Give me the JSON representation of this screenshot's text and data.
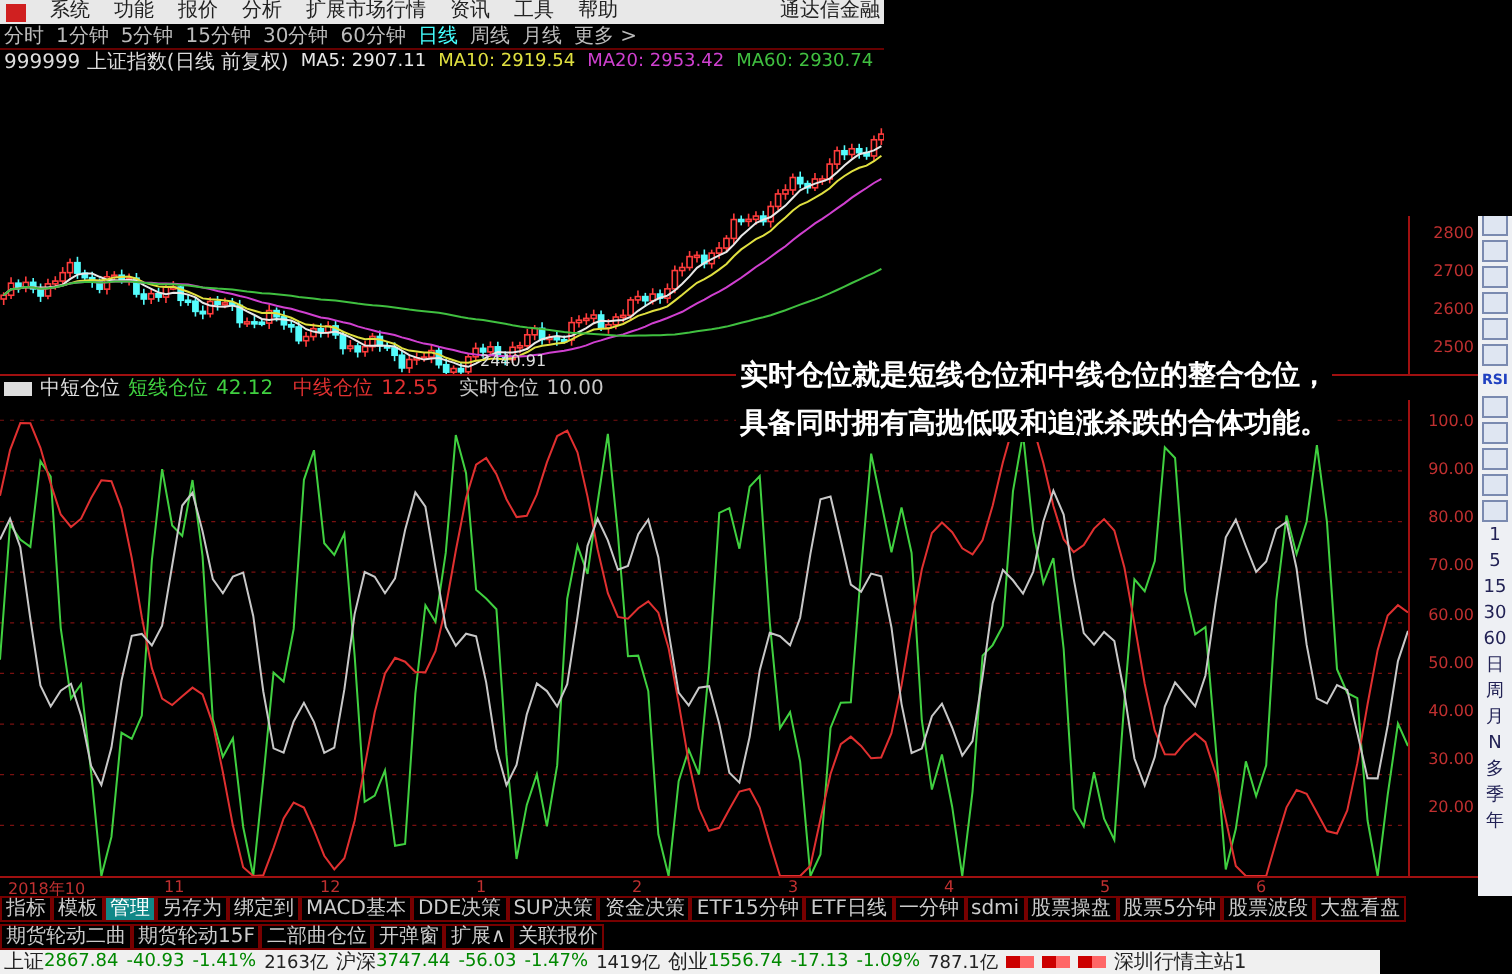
{
  "menu": {
    "items": [
      "系统",
      "功能",
      "报价",
      "分析",
      "扩展市场行情",
      "资讯",
      "工具",
      "帮助"
    ],
    "app_title": "通达信金融"
  },
  "periods": [
    {
      "label": "分时",
      "selected": false
    },
    {
      "label": "1分钟",
      "selected": false
    },
    {
      "label": "5分钟",
      "selected": false
    },
    {
      "label": "15分钟",
      "selected": false
    },
    {
      "label": "30分钟",
      "selected": false
    },
    {
      "label": "60分钟",
      "selected": false
    },
    {
      "label": "日线",
      "selected": true
    },
    {
      "label": "周线",
      "selected": false
    },
    {
      "label": "月线",
      "selected": false
    },
    {
      "label": "更多 >",
      "selected": false
    }
  ],
  "info": {
    "title": "999999 上证指数(日线 前复权)",
    "averages": [
      {
        "label": "MA5: 2907.11",
        "color": "#e8e8e8"
      },
      {
        "label": "MA10: 2919.54",
        "color": "#e0e040"
      },
      {
        "label": "MA20: 2953.42",
        "color": "#d040d0"
      },
      {
        "label": "MA60: 2930.74",
        "color": "#40c040"
      }
    ]
  },
  "price_axis": [
    "2800",
    "2700",
    "2600",
    "2500"
  ],
  "low_label": "2440.91",
  "indicator": {
    "name": "中短仓位",
    "lines": [
      {
        "label": "短线仓位",
        "value": "42.12",
        "color": "#40d040"
      },
      {
        "label": "中线仓位",
        "value": "12.55",
        "color": "#e03030"
      },
      {
        "label": "实时仓位",
        "value": "10.00",
        "color": "#c8c8c8"
      }
    ]
  },
  "indicator_axis": [
    "100.0",
    "90.00",
    "80.00",
    "70.00",
    "60.00",
    "50.00",
    "40.00",
    "30.00",
    "20.00"
  ],
  "annotation": [
    "实时仓位就是短线仓位和中线仓位的整合仓位，",
    "具备同时拥有高抛低吸和追涨杀跌的合体功能。"
  ],
  "toolbar": {
    "label": "RSI",
    "buttons": [
      "1",
      "5",
      "15",
      "30",
      "60",
      "日",
      "周",
      "月",
      "N",
      "多",
      "季",
      "年"
    ]
  },
  "date_axis": [
    "2018年10",
    "11",
    "12",
    "1",
    "2",
    "3",
    "4",
    "5",
    "6"
  ],
  "tabs": [
    {
      "label": "指标",
      "selected": false
    },
    {
      "label": "模板",
      "selected": false
    },
    {
      "label": "管理",
      "selected": true
    },
    {
      "label": "另存为",
      "selected": false
    },
    {
      "label": "绑定到",
      "selected": false
    },
    {
      "label": "MACD基本",
      "selected": false
    },
    {
      "label": "DDE决策",
      "selected": false
    },
    {
      "label": "SUP决策",
      "selected": false
    },
    {
      "label": "资金决策",
      "selected": false
    },
    {
      "label": "ETF15分钟",
      "selected": false
    },
    {
      "label": "ETF日线",
      "selected": false
    },
    {
      "label": "一分钟",
      "selected": false
    },
    {
      "label": "sdmi",
      "selected": false
    },
    {
      "label": "股票操盘",
      "selected": false
    },
    {
      "label": "股票5分钟",
      "selected": false
    },
    {
      "label": "股票波段",
      "selected": false
    },
    {
      "label": "大盘看盘",
      "selected": false
    },
    {
      "label": "期货轮动二曲",
      "selected": false
    },
    {
      "label": "期货轮动15F",
      "selected": false
    },
    {
      "label": "二部曲仓位",
      "selected": false
    }
  ],
  "tab_actions": [
    "开弹窗",
    "扩展∧",
    "关联报价"
  ],
  "status_bar": {
    "indices": [
      {
        "name": "上证",
        "value": "2867.84",
        "change": "-40.93",
        "percent": "-1.41%",
        "amount": "2163亿"
      },
      {
        "name": "沪深",
        "value": "3747.44",
        "change": "-56.03",
        "percent": "-1.47%",
        "amount": "1419亿"
      },
      {
        "name": "创业",
        "value": "1556.74",
        "change": "-17.13",
        "percent": "-1.09%",
        "amount": "787.1亿"
      }
    ],
    "server": "深圳行情主站1"
  }
}
